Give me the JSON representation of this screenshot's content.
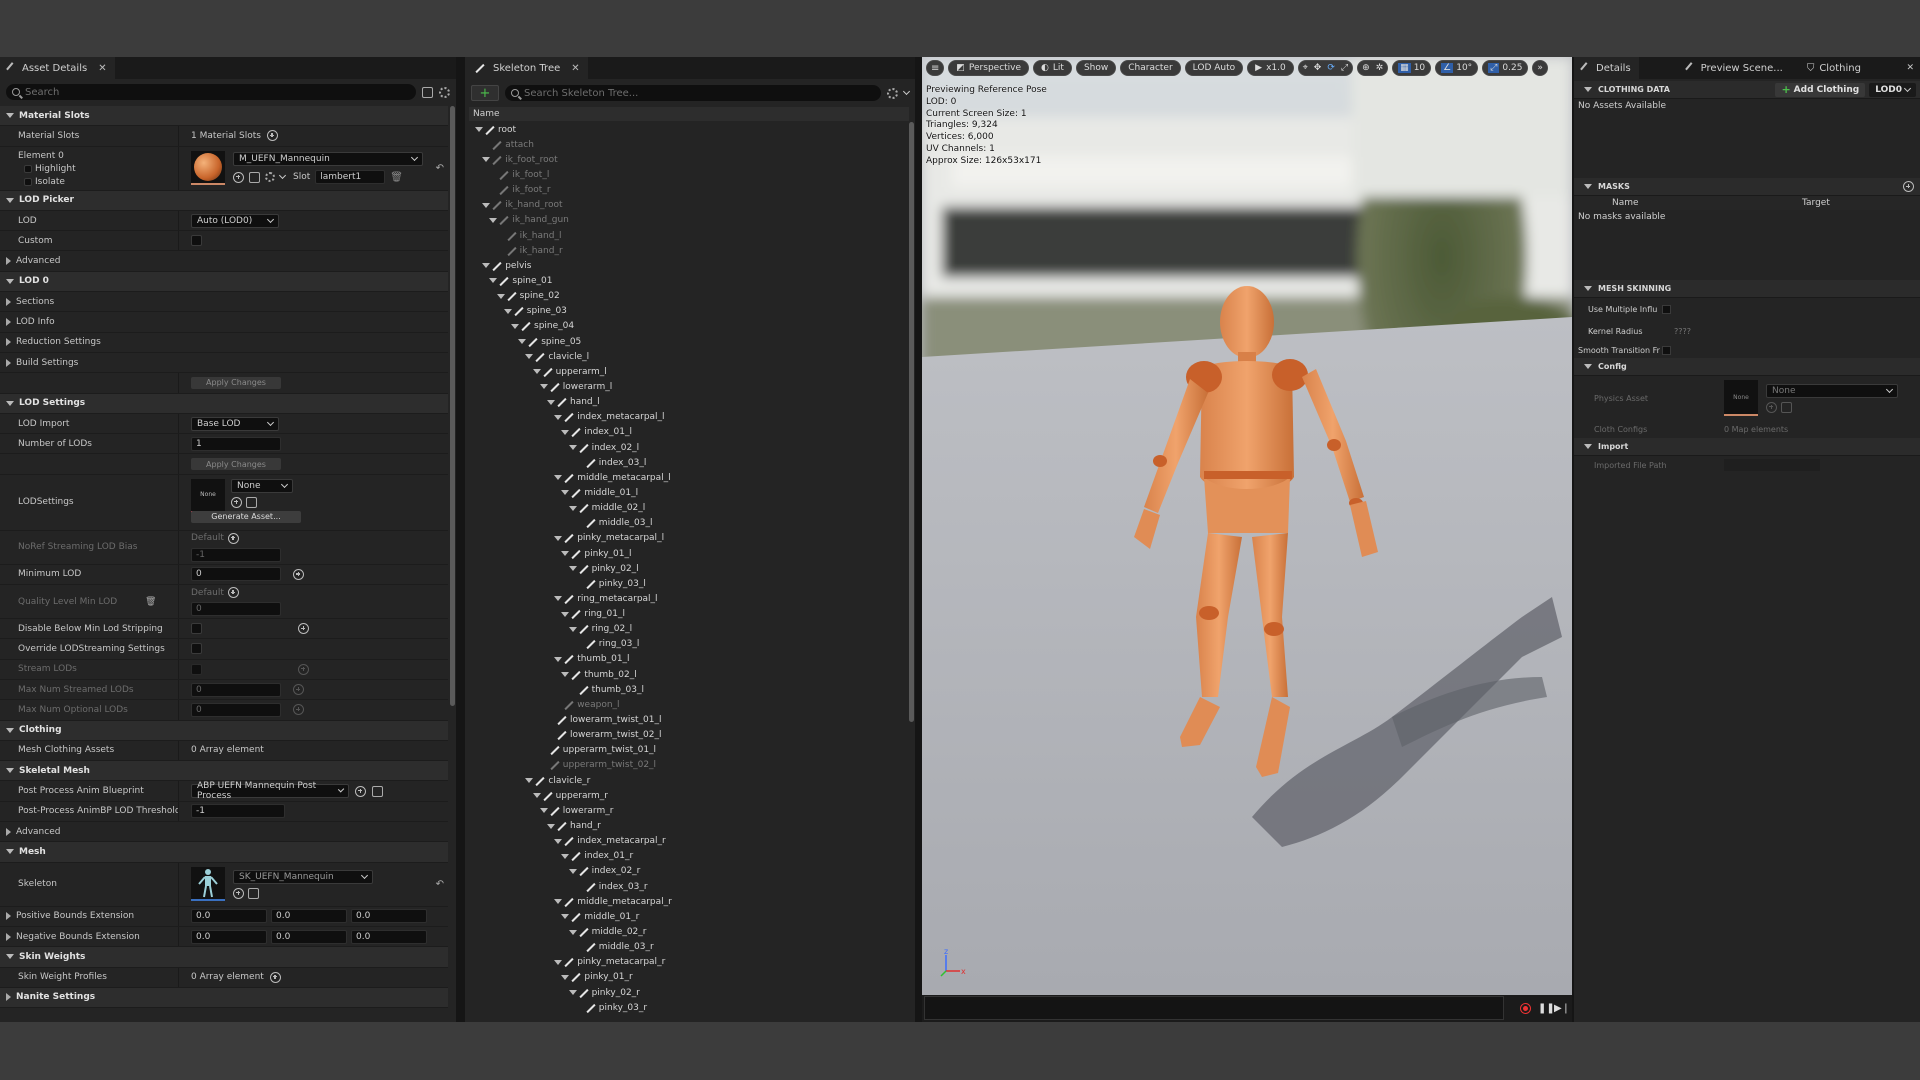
{
  "asset_details": {
    "tab_label": "Asset Details",
    "search_placeholder": "Search",
    "material_slots": {
      "header": "Material Slots",
      "label": "Material Slots",
      "count": "1 Material Slots",
      "element": "Element 0",
      "highlight": "Highlight",
      "isolate": "Isolate",
      "material": "M_UEFN_Mannequin",
      "slot_label": "Slot",
      "slot_value": "lambert1"
    },
    "lod_picker": {
      "header": "LOD Picker",
      "lod_label": "LOD",
      "lod_value": "Auto (LOD0)",
      "custom_label": "Custom",
      "advanced": "Advanced"
    },
    "lod0": {
      "header": "LOD 0",
      "sections": "Sections",
      "lod_info": "LOD Info",
      "reduction": "Reduction Settings",
      "build": "Build Settings",
      "apply": "Apply Changes"
    },
    "lod_settings": {
      "header": "LOD Settings",
      "lod_import_label": "LOD Import",
      "lod_import_value": "Base LOD",
      "num_lods_label": "Number of LODs",
      "num_lods_value": "1",
      "apply": "Apply Changes",
      "lodsettings_label": "LODSettings",
      "none_thumb": "None",
      "none_combo": "None",
      "generate": "Generate Asset...",
      "nonet_label": "NoRef Streaming LOD Bias",
      "default_1": "Default",
      "nonet_value": "-1",
      "min_lod_label": "Minimum LOD",
      "min_lod_value": "0",
      "quality_label": "Quality Level Min LOD",
      "default_2": "Default",
      "quality_value": "0",
      "disable_below_label": "Disable Below Min Lod Stripping",
      "override_label": "Override LODStreaming Settings",
      "stream_lods_label": "Stream LODs",
      "max_streamed_label": "Max Num Streamed LODs",
      "max_streamed_value": "0",
      "max_optional_label": "Max Num Optional LODs",
      "max_optional_value": "0"
    },
    "clothing": {
      "header": "Clothing",
      "label": "Mesh Clothing Assets",
      "value": "0 Array element"
    },
    "skeletal_mesh": {
      "header": "Skeletal Mesh",
      "ppab_label": "Post Process Anim Blueprint",
      "ppab_value": "ABP UEFN Mannequin Post Process",
      "threshold_label": "Post-Process AnimBP LOD Threshold",
      "threshold_value": "-1",
      "advanced": "Advanced"
    },
    "mesh": {
      "header": "Mesh",
      "skeleton_label": "Skeleton",
      "skeleton_value": "SK_UEFN_Mannequin",
      "pos_bounds_label": "Positive Bounds Extension",
      "pos_bounds": [
        "0.0",
        "0.0",
        "0.0"
      ],
      "neg_bounds_label": "Negative Bounds Extension",
      "neg_bounds": [
        "0.0",
        "0.0",
        "0.0"
      ]
    },
    "skin_weights": {
      "header": "Skin Weights",
      "label": "Skin Weight Profiles",
      "value": "0 Array element"
    },
    "nanite": {
      "header": "Nanite Settings"
    }
  },
  "skeleton_tree": {
    "tab_label": "Skeleton Tree",
    "search_placeholder": "Search Skeleton Tree...",
    "column_name": "Name",
    "bones": [
      {
        "name": "root",
        "depth": 0,
        "exp": true,
        "dim": false
      },
      {
        "name": "attach",
        "depth": 1,
        "exp": false,
        "dim": true
      },
      {
        "name": "ik_foot_root",
        "depth": 1,
        "exp": true,
        "dim": true
      },
      {
        "name": "ik_foot_l",
        "depth": 2,
        "exp": false,
        "dim": true
      },
      {
        "name": "ik_foot_r",
        "depth": 2,
        "exp": false,
        "dim": true
      },
      {
        "name": "ik_hand_root",
        "depth": 1,
        "exp": true,
        "dim": true
      },
      {
        "name": "ik_hand_gun",
        "depth": 2,
        "exp": true,
        "dim": true
      },
      {
        "name": "ik_hand_l",
        "depth": 3,
        "exp": false,
        "dim": true
      },
      {
        "name": "ik_hand_r",
        "depth": 3,
        "exp": false,
        "dim": true
      },
      {
        "name": "pelvis",
        "depth": 1,
        "exp": true,
        "dim": false
      },
      {
        "name": "spine_01",
        "depth": 2,
        "exp": true,
        "dim": false
      },
      {
        "name": "spine_02",
        "depth": 3,
        "exp": true,
        "dim": false
      },
      {
        "name": "spine_03",
        "depth": 4,
        "exp": true,
        "dim": false
      },
      {
        "name": "spine_04",
        "depth": 5,
        "exp": true,
        "dim": false
      },
      {
        "name": "spine_05",
        "depth": 6,
        "exp": true,
        "dim": false
      },
      {
        "name": "clavicle_l",
        "depth": 7,
        "exp": true,
        "dim": false
      },
      {
        "name": "upperarm_l",
        "depth": 8,
        "exp": true,
        "dim": false
      },
      {
        "name": "lowerarm_l",
        "depth": 9,
        "exp": true,
        "dim": false
      },
      {
        "name": "hand_l",
        "depth": 10,
        "exp": true,
        "dim": false
      },
      {
        "name": "index_metacarpal_l",
        "depth": 11,
        "exp": true,
        "dim": false
      },
      {
        "name": "index_01_l",
        "depth": 12,
        "exp": true,
        "dim": false
      },
      {
        "name": "index_02_l",
        "depth": 13,
        "exp": true,
        "dim": false
      },
      {
        "name": "index_03_l",
        "depth": 14,
        "exp": false,
        "dim": false
      },
      {
        "name": "middle_metacarpal_l",
        "depth": 11,
        "exp": true,
        "dim": false
      },
      {
        "name": "middle_01_l",
        "depth": 12,
        "exp": true,
        "dim": false
      },
      {
        "name": "middle_02_l",
        "depth": 13,
        "exp": true,
        "dim": false
      },
      {
        "name": "middle_03_l",
        "depth": 14,
        "exp": false,
        "dim": false
      },
      {
        "name": "pinky_metacarpal_l",
        "depth": 11,
        "exp": true,
        "dim": false
      },
      {
        "name": "pinky_01_l",
        "depth": 12,
        "exp": true,
        "dim": false
      },
      {
        "name": "pinky_02_l",
        "depth": 13,
        "exp": true,
        "dim": false
      },
      {
        "name": "pinky_03_l",
        "depth": 14,
        "exp": false,
        "dim": false
      },
      {
        "name": "ring_metacarpal_l",
        "depth": 11,
        "exp": true,
        "dim": false
      },
      {
        "name": "ring_01_l",
        "depth": 12,
        "exp": true,
        "dim": false
      },
      {
        "name": "ring_02_l",
        "depth": 13,
        "exp": true,
        "dim": false
      },
      {
        "name": "ring_03_l",
        "depth": 14,
        "exp": false,
        "dim": false
      },
      {
        "name": "thumb_01_l",
        "depth": 11,
        "exp": true,
        "dim": false
      },
      {
        "name": "thumb_02_l",
        "depth": 12,
        "exp": true,
        "dim": false
      },
      {
        "name": "thumb_03_l",
        "depth": 13,
        "exp": false,
        "dim": false
      },
      {
        "name": "weapon_l",
        "depth": 11,
        "exp": false,
        "dim": true
      },
      {
        "name": "lowerarm_twist_01_l",
        "depth": 10,
        "exp": false,
        "dim": false
      },
      {
        "name": "lowerarm_twist_02_l",
        "depth": 10,
        "exp": false,
        "dim": false
      },
      {
        "name": "upperarm_twist_01_l",
        "depth": 9,
        "exp": false,
        "dim": false
      },
      {
        "name": "upperarm_twist_02_l",
        "depth": 9,
        "exp": false,
        "dim": true
      },
      {
        "name": "clavicle_r",
        "depth": 7,
        "exp": true,
        "dim": false
      },
      {
        "name": "upperarm_r",
        "depth": 8,
        "exp": true,
        "dim": false
      },
      {
        "name": "lowerarm_r",
        "depth": 9,
        "exp": true,
        "dim": false
      },
      {
        "name": "hand_r",
        "depth": 10,
        "exp": true,
        "dim": false
      },
      {
        "name": "index_metacarpal_r",
        "depth": 11,
        "exp": true,
        "dim": false
      },
      {
        "name": "index_01_r",
        "depth": 12,
        "exp": true,
        "dim": false
      },
      {
        "name": "index_02_r",
        "depth": 13,
        "exp": true,
        "dim": false
      },
      {
        "name": "index_03_r",
        "depth": 14,
        "exp": false,
        "dim": false
      },
      {
        "name": "middle_metacarpal_r",
        "depth": 11,
        "exp": true,
        "dim": false
      },
      {
        "name": "middle_01_r",
        "depth": 12,
        "exp": true,
        "dim": false
      },
      {
        "name": "middle_02_r",
        "depth": 13,
        "exp": true,
        "dim": false
      },
      {
        "name": "middle_03_r",
        "depth": 14,
        "exp": false,
        "dim": false
      },
      {
        "name": "pinky_metacarpal_r",
        "depth": 11,
        "exp": true,
        "dim": false
      },
      {
        "name": "pinky_01_r",
        "depth": 12,
        "exp": true,
        "dim": false
      },
      {
        "name": "pinky_02_r",
        "depth": 13,
        "exp": true,
        "dim": false
      },
      {
        "name": "pinky_03_r",
        "depth": 14,
        "exp": false,
        "dim": false
      }
    ]
  },
  "viewport": {
    "perspective": "Perspective",
    "lit": "Lit",
    "show": "Show",
    "character": "Character",
    "lod_auto": "LOD Auto",
    "play_speed": "x1.0",
    "grid_value": "10",
    "angle_value": "10°",
    "scale_value": "0.25",
    "stats": [
      "Previewing Reference Pose",
      "LOD: 0",
      "Current Screen Size: 1",
      "Triangles: 9,324",
      "Vertices: 6,000",
      "UV Channels: 1",
      "Approx Size: 126x53x171"
    ],
    "axis_z": "z",
    "axis_x": "x"
  },
  "right_panel": {
    "tabs": [
      "Details",
      "Preview Scene...",
      "Clothing"
    ],
    "clothing_data": {
      "header": "CLOTHING DATA",
      "add": "Add Clothing",
      "lod": "LOD0",
      "empty": "No Assets Available"
    },
    "masks": {
      "header": "MASKS",
      "col_name": "Name",
      "col_target": "Target",
      "empty": "No masks available"
    },
    "mesh_skinning": {
      "header": "MESH SKINNING",
      "use_multiple": "Use Multiple Influ",
      "kernel_label": "Kernel Radius",
      "kernel_value": "????",
      "smooth": "Smooth Transition Fr"
    },
    "config": {
      "header": "Config",
      "physics_label": "Physics Asset",
      "thumb": "None",
      "physics_value": "None",
      "cloth_label": "Cloth Configs",
      "cloth_value": "0 Map elements"
    },
    "import": {
      "header": "Import",
      "path_label": "Imported File Path"
    }
  },
  "colors": {
    "accent_blue": "#2f5fa8",
    "add_green": "#4cc04c",
    "mannequin": "#e8915a",
    "record_red": "#e33333"
  }
}
